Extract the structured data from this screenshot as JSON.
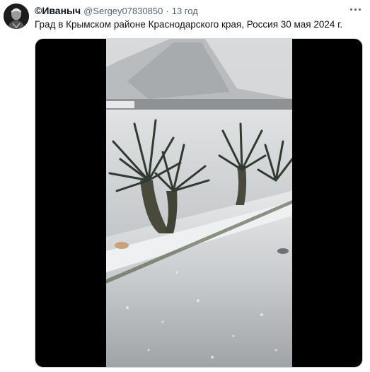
{
  "tweet": {
    "author_name": "©Иваныч",
    "author_handle": "@Sergey07830850",
    "separator": "·",
    "time": "13 год",
    "text": "Град в Крымском районе Краснодарского края, Россия 30 мая 2024 г."
  },
  "icons": {
    "avatar": "avatar-portrait",
    "more": "more-horizontal-icon"
  },
  "media": {
    "type": "video",
    "scene": "hail-covered-yard"
  }
}
